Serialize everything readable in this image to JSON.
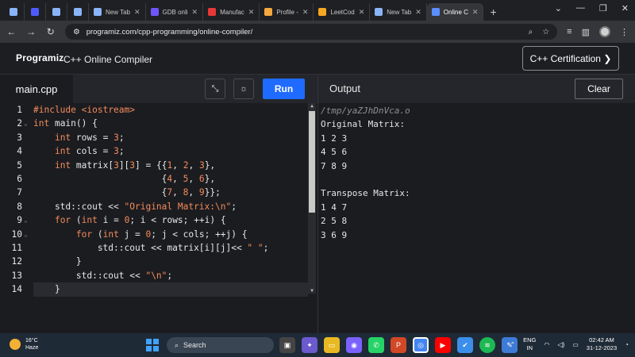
{
  "browser": {
    "tabs": [
      {
        "title": "",
        "color": "#8ab4f8",
        "icon": "globe-icon"
      },
      {
        "title": "",
        "color": "#4f5bff",
        "icon": "programiz-icon"
      },
      {
        "title": "",
        "color": "#8ab4f8",
        "icon": "globe-icon"
      },
      {
        "title": "",
        "color": "#8ab4f8",
        "icon": "globe-icon"
      },
      {
        "title": "New Tab",
        "color": "#8ab4f8",
        "icon": "globe-icon"
      },
      {
        "title": "GDB onli",
        "color": "#6f55ff",
        "icon": "gdb-icon"
      },
      {
        "title": "Manufac",
        "color": "#e83737",
        "icon": "manufac-icon"
      },
      {
        "title": "Profile -",
        "color": "#f3a93c",
        "icon": "profile-icon"
      },
      {
        "title": "LeetCod",
        "color": "#f5a623",
        "icon": "leetcode-icon"
      },
      {
        "title": "New Tab",
        "color": "#8ab4f8",
        "icon": "globe-icon"
      },
      {
        "title": "Online C",
        "color": "#5c8dff",
        "icon": "programiz-icon",
        "active": true
      }
    ],
    "url": "programiz.com/cpp-programming/online-compiler/"
  },
  "site": {
    "logo": "Programiz",
    "title": "C++ Online Compiler",
    "cert_button": "C++ Certification ❯"
  },
  "editor": {
    "filename": "main.cpp",
    "run_label": "Run",
    "line_numbers": [
      "1",
      "2",
      "3",
      "4",
      "5",
      "6",
      "7",
      "8",
      "9",
      "10",
      "11",
      "12",
      "13",
      "14"
    ],
    "lines": [
      "#include <iostream>",
      "int main() {",
      "    int rows = 3;",
      "    int cols = 3;",
      "    int matrix[3][3] = {{1, 2, 3},",
      "                        {4, 5, 6},",
      "                        {7, 8, 9}};",
      "    std::cout << \"Original Matrix:\\n\";",
      "    for (int i = 0; i < rows; ++i) {",
      "        for (int j = 0; j < cols; ++j) {",
      "            std::cout << matrix[i][j]<< \" \";",
      "        }",
      "        std::cout << \"\\n\";",
      "    }"
    ]
  },
  "output": {
    "label": "Output",
    "clear_label": "Clear",
    "lines": [
      "/tmp/yaZJhDnVca.o",
      "Original Matrix:",
      "1 2 3",
      "4 5 6",
      "7 8 9",
      "",
      "Transpose Matrix:",
      "1 4 7",
      "2 5 8",
      "3 6 9"
    ]
  },
  "taskbar": {
    "weather_temp": "16°C",
    "weather_desc": "Haze",
    "search_placeholder": "Search",
    "lang_top": "ENG",
    "lang_bottom": "IN",
    "time": "02:42 AM",
    "date": "31-12-2023"
  }
}
